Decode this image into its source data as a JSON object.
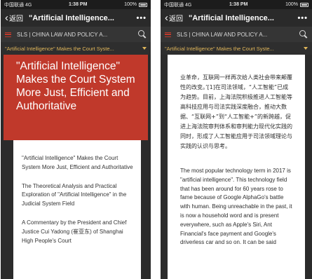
{
  "status": {
    "carrier": "中国联通 4G",
    "time": "1:38 PM",
    "battery": "100%"
  },
  "nav": {
    "back_label": "返回",
    "title": "\"Artificial Intelligence...",
    "more": "•••"
  },
  "breadcrumb": "SLS | CHINA LAW AND POLICY A...",
  "article_bar_title": "\"Artificial Intelligence\" Makes the Court Syste...",
  "left": {
    "hero_title": "\"Artificial Intelligence\" Makes the Court System More Just, Efficient and Authoritative",
    "toc": [
      "\"Artificial Intelligence\" Makes the Court System More Just, Efficient and Authoritative",
      "The Theoretical Analysis and Practical Exploration of \"Artificial Intelligence\" in the Judicial System Field",
      "A Commentary by the President and Chief Justice Cui Yadong (崔亚东) of Shanghai High People's Court"
    ]
  },
  "right": {
    "zh_text": "业革命，互联网一样再次给人类社会带来颠覆性的改变。’[1]在司法领域，“人工智能”已成为趋势。目前，上海法院积极推进人工智能等高科技应用与司法实践深度融合，推动大数据、“互联网+”到“人工智能+”的新跨越，促进上海法院审判体系和审判能力现代化实践的同时，形成了人工智能应用于司法领域理论与实践的认识与思考。",
    "en_text": "The most popular technology term in 2017 is \"artificial intelligence\". This technology field that has been around for 60 years rose to fame because of Google AlphaGo's battle with human. Being unreachable in the past, it is now a household word and is present everywhere, such as Apple's Siri, Ant Financial's face payment and Google's driverless car and so on. It can be said"
  }
}
